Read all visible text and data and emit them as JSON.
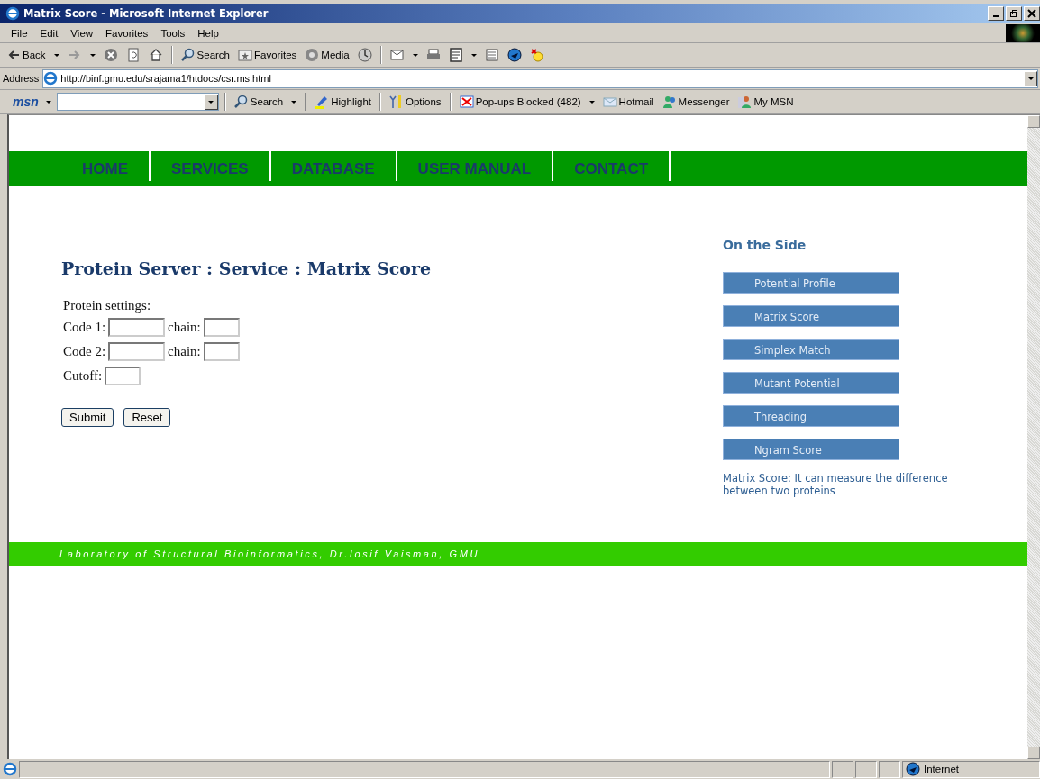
{
  "window": {
    "title": "Matrix Score - Microsoft Internet Explorer"
  },
  "menu_bar": [
    "File",
    "Edit",
    "View",
    "Favorites",
    "Tools",
    "Help"
  ],
  "toolbar": [
    {
      "kind": "back",
      "label": "Back"
    },
    {
      "kind": "forward"
    },
    {
      "kind": "stop"
    },
    {
      "kind": "refresh"
    },
    {
      "kind": "home"
    },
    {
      "kind": "sep"
    },
    {
      "kind": "search",
      "label": "Search"
    },
    {
      "kind": "favorites",
      "label": "Favorites"
    },
    {
      "kind": "media",
      "label": "Media"
    },
    {
      "kind": "history"
    },
    {
      "kind": "sep"
    },
    {
      "kind": "mail"
    },
    {
      "kind": "print"
    },
    {
      "kind": "edit"
    },
    {
      "kind": "discuss"
    },
    {
      "kind": "messenger"
    },
    {
      "kind": "yahoo"
    }
  ],
  "address_bar": {
    "label": "Address",
    "url": "http://binf.gmu.edu/srajama1/htdocs/csr.ms.html"
  },
  "msn_bar": {
    "logo": "msn",
    "items": [
      {
        "kind": "search",
        "label": "Search"
      },
      {
        "kind": "highlight",
        "label": "Highlight"
      },
      {
        "kind": "options",
        "label": "Options"
      },
      {
        "kind": "popups",
        "label": "Pop-ups Blocked (482)"
      },
      {
        "kind": "hotmail",
        "label": "Hotmail"
      },
      {
        "kind": "messenger",
        "label": "Messenger"
      },
      {
        "kind": "mymsn",
        "label": "My MSN"
      }
    ]
  },
  "nav": [
    "HOME",
    "SERVICES",
    "DATABASE",
    "USER MANUAL",
    "CONTACT"
  ],
  "page": {
    "heading": "Protein Server : Service : Matrix Score",
    "form_title": "Protein settings:",
    "rows": [
      {
        "label": "Code 1:",
        "kind": "pair",
        "chain_label": "chain:"
      },
      {
        "label": "Code 2:",
        "kind": "pair",
        "chain_label": "chain:"
      },
      {
        "label": "Cutoff:",
        "kind": "single"
      }
    ],
    "buttons": [
      "Submit",
      "Reset"
    ]
  },
  "sidebar": {
    "title": "On the Side",
    "items": [
      {
        "label": "Potential Profile"
      },
      {
        "label": "Matrix Score"
      },
      {
        "label": "Simplex Match"
      },
      {
        "label": "Mutant Potential"
      },
      {
        "label": "Threading"
      },
      {
        "label": "Ngram Score"
      }
    ],
    "description": "Matrix Score: It can measure the difference between two proteins"
  },
  "footer": "Laboratory of Structural Bioinformatics, Dr.Iosif Vaisman, GMU",
  "status_bar": {
    "zone": "Internet"
  }
}
